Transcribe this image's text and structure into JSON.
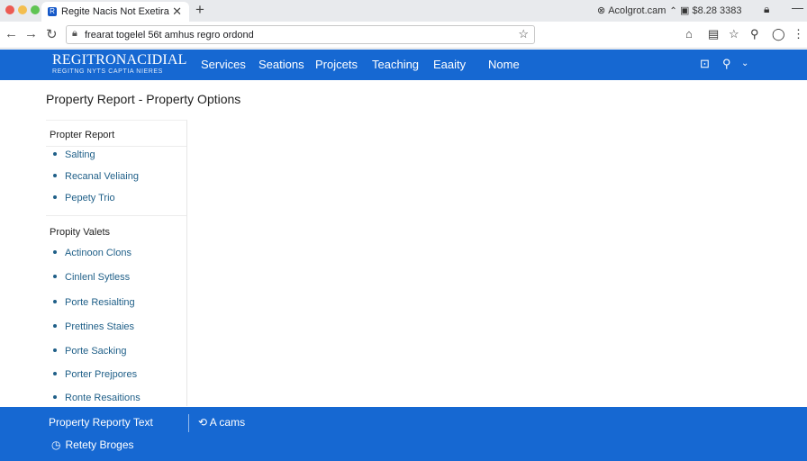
{
  "browser": {
    "tab_title": "Regite Nacis Not Exetira",
    "tab_favicon_glyph": "R",
    "new_tab_glyph": "+",
    "profile_text": "Acolgrot.cam",
    "extension_text": "$8.28 3383",
    "url": "frearat togelel 56t amhus regro ordond",
    "colors": {
      "tab_strip": "#e8eaed",
      "close_red": "#ec5b53",
      "minimize_yellow": "#f3be4f",
      "maximize_green": "#5fc453"
    }
  },
  "header": {
    "logo_main": "REGITRONACIDIAL",
    "logo_sub": "REGITNG NYTS CAPTIA NIERES",
    "nav": [
      "Services",
      "Seations",
      "Projcets",
      "Teaching",
      "Eaaity",
      "Nome"
    ],
    "color": "#1668d2"
  },
  "page": {
    "title": "Property Report - Property Options"
  },
  "sidebar": {
    "sections": [
      {
        "title": "Propter Report",
        "items": [
          "Salting",
          "Recanal Veliaing",
          "Pepety Trio"
        ]
      },
      {
        "title": "Propity Valets",
        "items": [
          "Actinoon Clons",
          "Cinlenl Sytless",
          "Porte Resialting",
          "Prettines Staies",
          "Porte Sacking",
          "Porter Prejpores",
          "Ronte Resaitions"
        ]
      }
    ],
    "link_color": "#1f5f88"
  },
  "footer": {
    "title": "Property Reporty Text",
    "action_label": "A cams",
    "link_label": "Retety Broges",
    "color": "#1668d2"
  }
}
